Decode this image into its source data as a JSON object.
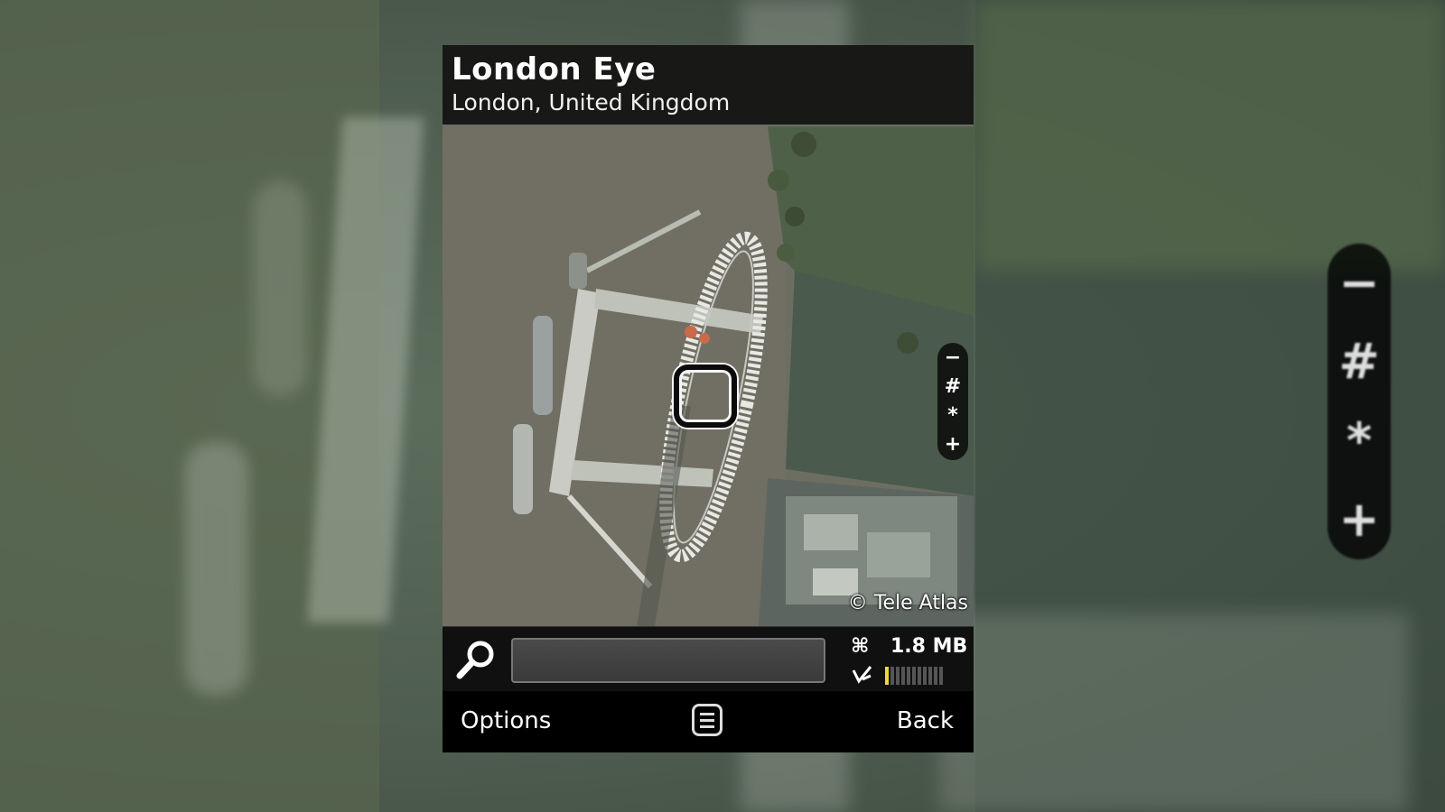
{
  "place": {
    "title": "London Eye",
    "subtitle": "London, United Kingdom"
  },
  "map": {
    "copyright": "© Tele Atlas",
    "view": "satellite"
  },
  "zoom_controls": {
    "zoom_out": "−",
    "zoom_out_key": "#",
    "zoom_in_key": "*",
    "zoom_in": "+"
  },
  "search": {
    "icon": "magnifier-icon",
    "value": ""
  },
  "status": {
    "data_icon": "data-transfer-icon",
    "data_size": "1.8 MB",
    "signal_icon": "connection-icon",
    "signal_level": 0.1
  },
  "softkeys": {
    "left": "Options",
    "middle_icon": "menu-icon",
    "right": "Back"
  },
  "colors": {
    "signal_active": "#f0d83a",
    "header_bg": "#0c0c0c"
  }
}
